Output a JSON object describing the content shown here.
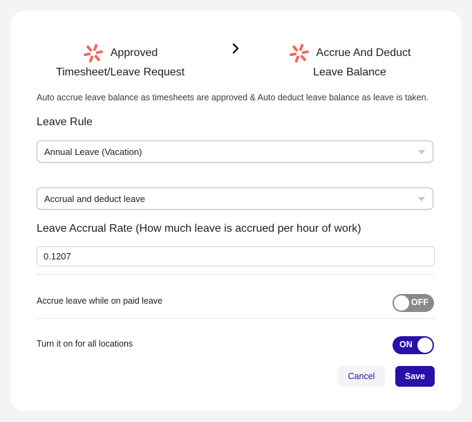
{
  "flow": {
    "step1": {
      "line1": "Approved",
      "line2": "Timesheet/Leave Request",
      "icon": "brand-logo-icon"
    },
    "arrow_icon": "chevron-right-icon",
    "step2": {
      "line1": "Accrue And Deduct",
      "line2": "Leave Balance",
      "icon": "brand-logo-icon"
    }
  },
  "description": "Auto accrue leave balance as timesheets are approved & Auto deduct leave balance as leave is taken.",
  "leave_rule": {
    "heading": "Leave Rule",
    "rule_select_value": "Annual Leave (Vacation)",
    "mode_select_value": "Accrual and deduct leave"
  },
  "accrual_rate": {
    "heading": "Leave Accrual Rate (How much leave is accrued per hour of work)",
    "value": "0.1207"
  },
  "settings": [
    {
      "label": "Accrue leave while on paid leave",
      "state": "OFF"
    },
    {
      "label": "Turn it on for all locations",
      "state": "ON"
    }
  ],
  "actions": {
    "cancel_label": "Cancel",
    "save_label": "Save"
  },
  "colors": {
    "accent": "#2a0fa8",
    "logo": "#f06a5a",
    "toggle_off": "#8a8a8e"
  }
}
